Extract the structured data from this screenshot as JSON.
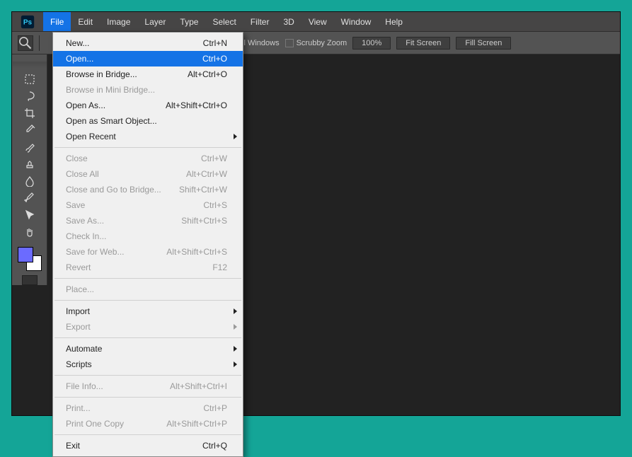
{
  "menubar": {
    "items": [
      "File",
      "Edit",
      "Image",
      "Layer",
      "Type",
      "Select",
      "Filter",
      "3D",
      "View",
      "Window",
      "Help"
    ],
    "open_index": 0
  },
  "options_bar": {
    "fit_options": "ll Windows",
    "scrubby": "Scrubby Zoom",
    "zoom_pct": "100%",
    "fit_screen": "Fit Screen",
    "fill_screen": "Fill Screen"
  },
  "dropdown": {
    "groups": [
      [
        {
          "label": "New...",
          "shortcut": "Ctrl+N"
        },
        {
          "label": "Open...",
          "shortcut": "Ctrl+O",
          "highlight": true
        },
        {
          "label": "Browse in Bridge...",
          "shortcut": "Alt+Ctrl+O"
        },
        {
          "label": "Browse in Mini Bridge...",
          "disabled": true
        },
        {
          "label": "Open As...",
          "shortcut": "Alt+Shift+Ctrl+O"
        },
        {
          "label": "Open as Smart Object..."
        },
        {
          "label": "Open Recent",
          "submenu": true
        }
      ],
      [
        {
          "label": "Close",
          "shortcut": "Ctrl+W",
          "disabled": true
        },
        {
          "label": "Close All",
          "shortcut": "Alt+Ctrl+W",
          "disabled": true
        },
        {
          "label": "Close and Go to Bridge...",
          "shortcut": "Shift+Ctrl+W",
          "disabled": true
        },
        {
          "label": "Save",
          "shortcut": "Ctrl+S",
          "disabled": true
        },
        {
          "label": "Save As...",
          "shortcut": "Shift+Ctrl+S",
          "disabled": true
        },
        {
          "label": "Check In...",
          "disabled": true
        },
        {
          "label": "Save for Web...",
          "shortcut": "Alt+Shift+Ctrl+S",
          "disabled": true
        },
        {
          "label": "Revert",
          "shortcut": "F12",
          "disabled": true
        }
      ],
      [
        {
          "label": "Place...",
          "disabled": true
        }
      ],
      [
        {
          "label": "Import",
          "submenu": true
        },
        {
          "label": "Export",
          "submenu": true,
          "disabled": true
        }
      ],
      [
        {
          "label": "Automate",
          "submenu": true
        },
        {
          "label": "Scripts",
          "submenu": true
        }
      ],
      [
        {
          "label": "File Info...",
          "shortcut": "Alt+Shift+Ctrl+I",
          "disabled": true
        }
      ],
      [
        {
          "label": "Print...",
          "shortcut": "Ctrl+P",
          "disabled": true
        },
        {
          "label": "Print One Copy",
          "shortcut": "Alt+Shift+Ctrl+P",
          "disabled": true
        }
      ],
      [
        {
          "label": "Exit",
          "shortcut": "Ctrl+Q"
        }
      ]
    ]
  },
  "tools": [
    "rect-marquee",
    "lasso",
    "crop",
    "eyedropper",
    "brush",
    "clone-stamp",
    "blur",
    "pen",
    "direct-select",
    "hand"
  ]
}
